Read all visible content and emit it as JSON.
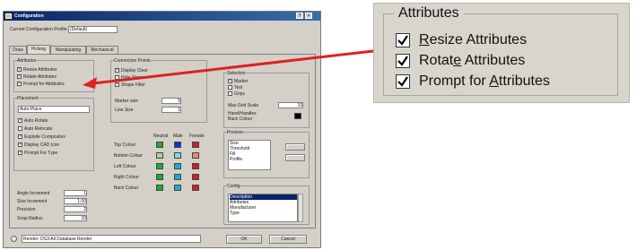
{
  "dialog": {
    "title": "Configuration",
    "current_profile_label": "Current Configuration Profile:",
    "current_profile_value": "(Default)",
    "tabs": [
      "Draw",
      "Picking",
      "Manipulating",
      "Mechanical"
    ],
    "attributes_group": {
      "title": "Attributes",
      "items": [
        "Resize Attributes",
        "Rotate Attributes",
        "Prompt for Attributes"
      ]
    },
    "placement_group": {
      "title": "Placement",
      "select_value": "Auto-Place",
      "options": [
        "Auto Rotate",
        "Auto Relocate",
        "Explode Composites",
        "Display CAD Icon",
        "Prompt For Type"
      ]
    },
    "numeric_fields": [
      {
        "label": "Angle Increment",
        "value": "1"
      },
      {
        "label": "Size Increment",
        "value": "1.00"
      },
      {
        "label": "Precision",
        "value": "2"
      },
      {
        "label": "Snap Radius",
        "value": "10"
      }
    ],
    "connection_group": {
      "title": "Connection Points",
      "items": [
        "Display Clear",
        "Hide Show",
        "Shape Filter"
      ],
      "fields": [
        {
          "label": "Marker size",
          "value": "5"
        },
        {
          "label": "Line Size",
          "value": "1"
        }
      ]
    },
    "color_group": {
      "headers": [
        "Neutral",
        "Male",
        "Female"
      ],
      "rows": [
        "Top Colour",
        "Bottom Colour",
        "Left Colour",
        "Right Colour",
        "Back Colour"
      ],
      "colors": [
        "#22aa33",
        "#1133cc",
        "#cc2222"
      ]
    },
    "selection_group": {
      "title": "Selection",
      "items": [
        "Marker",
        "Text",
        "Grips"
      ],
      "max_grid_label": "Max Grid Scale",
      "max_grid_value": "10",
      "hand_label": "Hand/Handles",
      "back_label": "Back Colour"
    },
    "preview_group": {
      "title": "Preview",
      "list": [
        "Size",
        "Threshold",
        "Fill",
        "Profile"
      ]
    },
    "config_group": {
      "title": "Config",
      "list": [
        "Description",
        "Attributes",
        "Manufacturer",
        "Type"
      ]
    },
    "status_text": "Render: DS3:All Database Render",
    "ok_label": "OK",
    "cancel_label": "Cancel"
  },
  "zoom": {
    "legend": "Attributes",
    "items": [
      {
        "label": "Resize Attributes",
        "mnemonic": "R"
      },
      {
        "label": "Rotate Attributes",
        "mnemonic": "e"
      },
      {
        "label": "Prompt for Attributes",
        "mnemonic": "A"
      }
    ]
  },
  "arrow_color": "#dd2222"
}
